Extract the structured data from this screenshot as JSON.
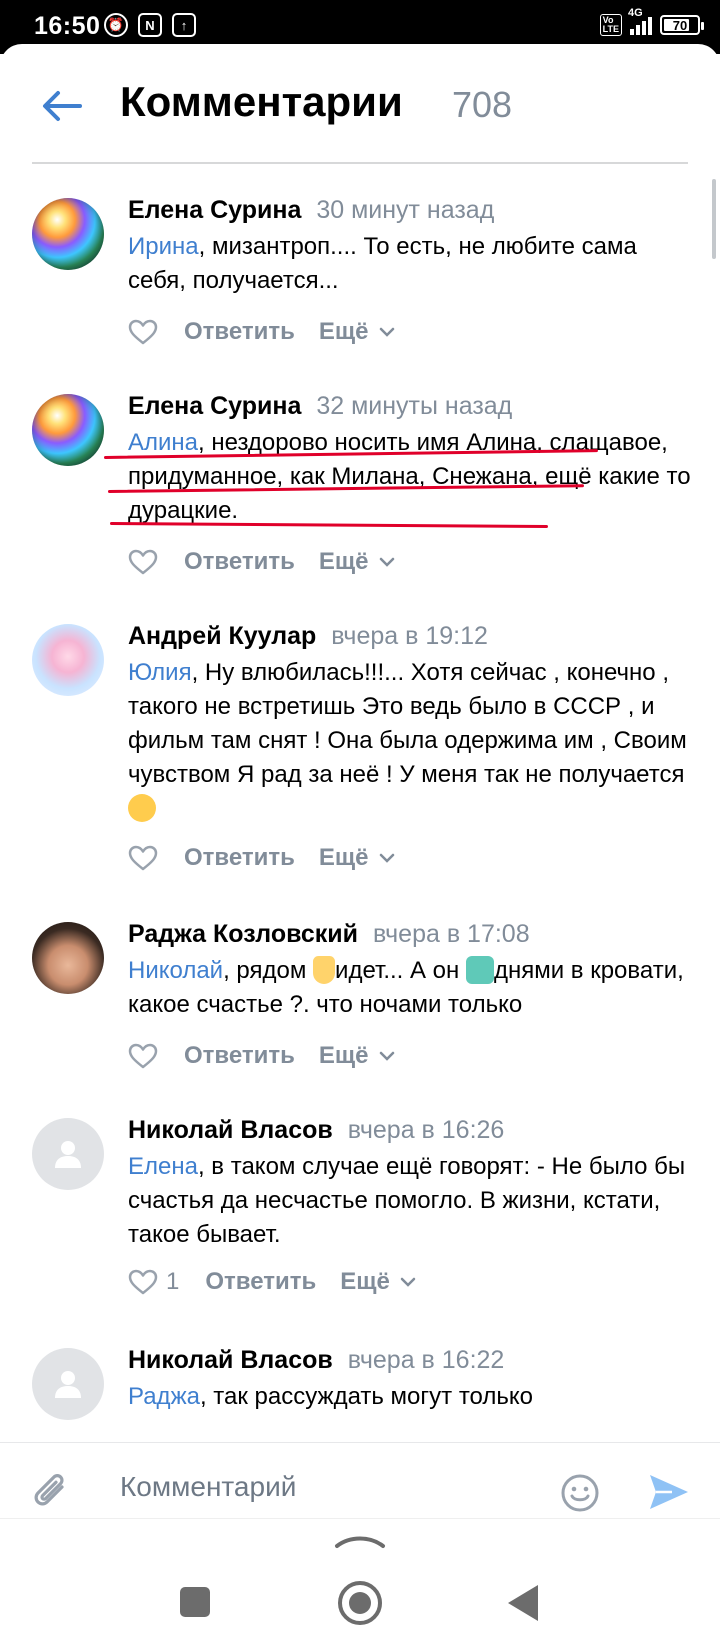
{
  "status_bar": {
    "time": "16:50",
    "network": "4G",
    "volte": "Vo LTE",
    "battery": "70",
    "battery_level": 0.7
  },
  "header": {
    "title": "Комментарии",
    "count": "708"
  },
  "comments": [
    {
      "author": "Елена Сурина",
      "time": "30 минут назад",
      "mention": "Ирина",
      "text": ", мизантроп.... То есть, не любите сама себя, получается...",
      "like_count": "",
      "reply": "Ответить",
      "more": "Ещё",
      "avatar": "orb-avatar"
    },
    {
      "author": "Елена Сурина",
      "time": "32 минуты назад",
      "mention": "Алина",
      "text": ", нездорово носить имя Алина, слащавое, придуманное, как Милана, Снежана, ещё какие то дурацкие.",
      "like_count": "",
      "reply": "Ответить",
      "more": "Ещё",
      "avatar": "orb-avatar"
    },
    {
      "author": "Андрей Куулар",
      "time": "вчера в 19:12",
      "mention": "Юлия",
      "text": ", Ну влюбилась!!!... Хотя сейчас , конечно , такого не встретишь Это ведь было в СССР , и фильм там снят ! Она была одержима им , Своим чувством Я рад за неё ! У меня так не получается",
      "like_count": "",
      "reply": "Ответить",
      "more": "Ещё",
      "avatar": "anime-avatar"
    },
    {
      "author": "Раджа Козловский",
      "time": "вчера в 17:08",
      "mention": "Николай",
      "text_a": ", рядом ",
      "text_b": "идет... А он ",
      "text_c": "днями в кровати, какое счастье ?. что ночами только",
      "like_count": "",
      "reply": "Ответить",
      "more": "Ещё",
      "avatar": "man-avatar"
    },
    {
      "author": "Николай Власов",
      "time": "вчера в 16:26",
      "mention": "Елена",
      "text": ", в таком случае ещё говорят: - Не было бы счастья да несчастье помогло. В жизни, кстати, такое бывает.",
      "like_count": "1",
      "reply": "Ответить",
      "more": "Ещё",
      "avatar": "default-avatar"
    },
    {
      "author": "Николай Власов",
      "time": "вчера в 16:22",
      "mention": "Раджа",
      "text": ", так рассуждать могут только",
      "avatar": "default-avatar"
    }
  ],
  "composer": {
    "placeholder": "Комментарий"
  },
  "colors": {
    "accent": "#3f7fcf",
    "secondary_text": "#818c99",
    "underline": "#e0002a"
  }
}
